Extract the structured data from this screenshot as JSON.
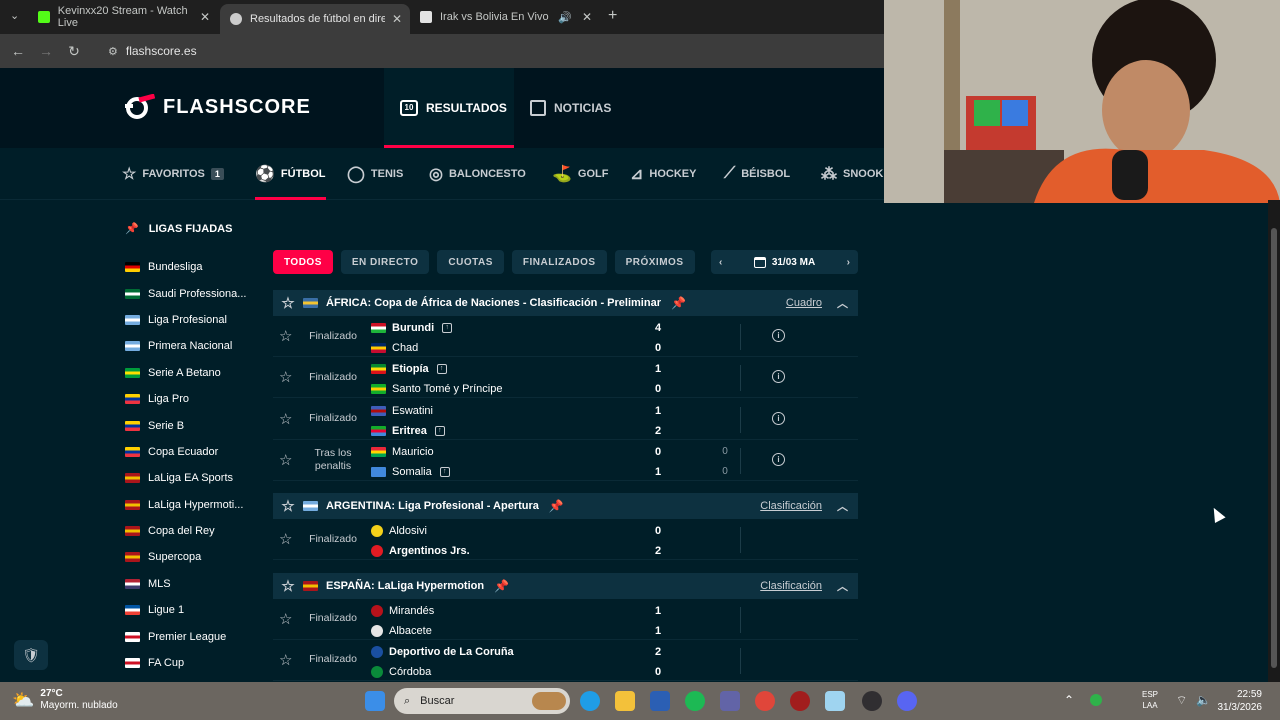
{
  "browser": {
    "tabs": [
      {
        "title": "Kevinxx20 Stream - Watch Live",
        "favicon_color": "#53fc18"
      },
      {
        "title": "Resultados de fútbol en directo",
        "favicon_color": "#cccccc"
      },
      {
        "title": "Irak vs Bolivia En Vivo | Rep",
        "favicon_color": "#e3e3e3"
      }
    ],
    "new_tab": "+",
    "url": "flashscore.es"
  },
  "header": {
    "brand": "FLASHSCORE",
    "nav": [
      {
        "label": "RESULTADOS",
        "icon": "scoreboard-icon"
      },
      {
        "label": "NOTICIAS",
        "icon": "news-icon"
      }
    ]
  },
  "sports": [
    {
      "label": "FAVORITOS",
      "icon": "star-icon",
      "badge": "1"
    },
    {
      "label": "FÚTBOL",
      "icon": "soccer-ball-icon"
    },
    {
      "label": "TENIS",
      "icon": "tennis-ball-icon"
    },
    {
      "label": "BALONCESTO",
      "icon": "basketball-icon"
    },
    {
      "label": "GOLF",
      "icon": "golf-icon"
    },
    {
      "label": "HOCKEY",
      "icon": "hockey-icon"
    },
    {
      "label": "BÉISBOL",
      "icon": "baseball-bat-icon"
    },
    {
      "label": "SNOOK",
      "icon": "snooker-icon"
    }
  ],
  "sidebar": {
    "title": "LIGAS FIJADAS",
    "leagues": [
      {
        "name": "Bundesliga",
        "flag": [
          "#000000",
          "#dd0000",
          "#ffce00"
        ]
      },
      {
        "name": "Saudi Professiona...",
        "flag": [
          "#006c35",
          "#ffffff",
          "#006c35"
        ]
      },
      {
        "name": "Liga Profesional",
        "flag": [
          "#74acdf",
          "#ffffff",
          "#74acdf"
        ]
      },
      {
        "name": "Primera Nacional",
        "flag": [
          "#74acdf",
          "#ffffff",
          "#74acdf"
        ]
      },
      {
        "name": "Serie A Betano",
        "flag": [
          "#009c3b",
          "#ffdf00",
          "#009c3b"
        ]
      },
      {
        "name": "Liga Pro",
        "flag": [
          "#ffd100",
          "#0033a0",
          "#ef3340"
        ]
      },
      {
        "name": "Serie B",
        "flag": [
          "#ffd100",
          "#0033a0",
          "#ef3340"
        ]
      },
      {
        "name": "Copa Ecuador",
        "flag": [
          "#ffd100",
          "#0033a0",
          "#ef3340"
        ]
      },
      {
        "name": "LaLiga EA Sports",
        "flag": [
          "#aa151b",
          "#f1bf00",
          "#aa151b"
        ]
      },
      {
        "name": "LaLiga Hypermoti...",
        "flag": [
          "#aa151b",
          "#f1bf00",
          "#aa151b"
        ]
      },
      {
        "name": "Copa del Rey",
        "flag": [
          "#aa151b",
          "#f1bf00",
          "#aa151b"
        ]
      },
      {
        "name": "Supercopa",
        "flag": [
          "#aa151b",
          "#f1bf00",
          "#aa151b"
        ]
      },
      {
        "name": "MLS",
        "flag": [
          "#b22234",
          "#ffffff",
          "#3c3b6e"
        ]
      },
      {
        "name": "Ligue 1",
        "flag": [
          "#0055a4",
          "#ffffff",
          "#ef4135"
        ]
      },
      {
        "name": "Premier League",
        "flag": [
          "#ffffff",
          "#ce1124",
          "#ffffff"
        ]
      },
      {
        "name": "FA Cup",
        "flag": [
          "#ffffff",
          "#ce1124",
          "#ffffff"
        ]
      }
    ]
  },
  "filters": {
    "buttons": [
      "TODOS",
      "EN DIRECTO",
      "CUOTAS",
      "FINALIZADOS",
      "PRÓXIMOS"
    ],
    "date": "31/03 MA"
  },
  "leagues": [
    {
      "name": "ÁFRICA: Copa de África de Naciones - Clasificación - Preliminar",
      "link": "Cuadro",
      "flag": [
        "#3a6ea5",
        "#f4c430",
        "#3a6ea5"
      ],
      "matches": [
        {
          "status": "Finalizado",
          "home": "Burundi",
          "away": "Chad",
          "home_score": "4",
          "away_score": "0",
          "winner": "home",
          "home_tv": true,
          "away_tv": false,
          "home_flag": [
            "#ce1126",
            "#ffffff",
            "#1eb53a"
          ],
          "away_flag": [
            "#002664",
            "#fecb00",
            "#c60c30"
          ],
          "pen_home": "",
          "pen_away": ""
        },
        {
          "status": "Finalizado",
          "home": "Etiopía",
          "away": "Santo Tomé y Príncipe",
          "home_score": "1",
          "away_score": "0",
          "winner": "home",
          "home_tv": true,
          "away_tv": false,
          "home_flag": [
            "#078930",
            "#fcdd09",
            "#da121a"
          ],
          "away_flag": [
            "#12ad2b",
            "#ffce00",
            "#12ad2b"
          ],
          "pen_home": "",
          "pen_away": ""
        },
        {
          "status": "Finalizado",
          "home": "Eswatini",
          "away": "Eritrea",
          "home_score": "1",
          "away_score": "2",
          "winner": "away",
          "home_tv": false,
          "away_tv": true,
          "home_flag": [
            "#3e5eb9",
            "#b10c0c",
            "#3e5eb9"
          ],
          "away_flag": [
            "#12ad2b",
            "#ea0437",
            "#4189dd"
          ],
          "pen_home": "",
          "pen_away": ""
        },
        {
          "status": "Tras los penaltis",
          "home": "Mauricio",
          "away": "Somalia",
          "home_score": "0",
          "away_score": "1",
          "winner": "none",
          "home_tv": false,
          "away_tv": true,
          "home_flag": [
            "#ea2839",
            "#ffd500",
            "#00a551"
          ],
          "away_flag": [
            "#4189dd",
            "#4189dd",
            "#4189dd"
          ],
          "pen_home": "0",
          "pen_away": "0"
        }
      ]
    },
    {
      "name": "ARGENTINA: Liga Profesional - Apertura",
      "link": "Clasificación",
      "flag": [
        "#74acdf",
        "#ffffff",
        "#74acdf"
      ],
      "matches": [
        {
          "status": "Finalizado",
          "home": "Aldosivi",
          "away": "Argentinos Jrs.",
          "home_score": "0",
          "away_score": "2",
          "winner": "away",
          "home_tv": false,
          "away_tv": false,
          "home_crest": "#f4d11a",
          "away_crest": "#e21b23",
          "pen_home": "",
          "pen_away": ""
        }
      ]
    },
    {
      "name": "ESPAÑA: LaLiga Hypermotion",
      "link": "Clasificación",
      "flag": [
        "#aa151b",
        "#f1bf00",
        "#aa151b"
      ],
      "matches": [
        {
          "status": "Finalizado",
          "home": "Mirandés",
          "away": "Albacete",
          "home_score": "1",
          "away_score": "1",
          "winner": "none",
          "home_tv": false,
          "away_tv": false,
          "home_crest": "#b7121b",
          "away_crest": "#e6e6e6",
          "pen_home": "",
          "pen_away": ""
        },
        {
          "status": "Finalizado",
          "home": "Deportivo de La Coruña",
          "away": "Córdoba",
          "home_score": "2",
          "away_score": "0",
          "winner": "home",
          "home_tv": false,
          "away_tv": false,
          "home_crest": "#1a4fa0",
          "away_crest": "#0a8a3a",
          "pen_home": "",
          "pen_away": ""
        }
      ]
    }
  ],
  "taskbar": {
    "temperature": "27°C",
    "weather": "Mayorm. nublado",
    "search": "Buscar",
    "lang_top": "ESP",
    "lang_bottom": "LAA",
    "time": "22:59",
    "date": "31/3/2026"
  }
}
